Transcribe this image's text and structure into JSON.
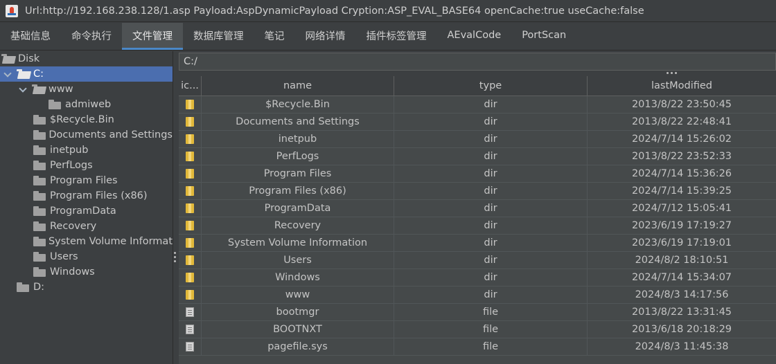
{
  "window": {
    "title": "Url:http://192.168.238.128/1.asp Payload:AspDynamicPayload Cryption:ASP_EVAL_BASE64 openCache:true useCache:false"
  },
  "tabs": [
    {
      "label": "基础信息"
    },
    {
      "label": "命令执行"
    },
    {
      "label": "文件管理",
      "active": true
    },
    {
      "label": "数据库管理"
    },
    {
      "label": "笔记"
    },
    {
      "label": "网络详情"
    },
    {
      "label": "插件标签管理"
    },
    {
      "label": "AEvalCode"
    },
    {
      "label": "PortScan"
    }
  ],
  "tree": {
    "root": "Disk",
    "drive_c": "C:",
    "www": "www",
    "admiweb": "admiweb",
    "items": [
      "$Recycle.Bin",
      "Documents and Settings",
      "inetpub",
      "PerfLogs",
      "Program Files",
      "Program Files (x86)",
      "ProgramData",
      "Recovery",
      "System Volume Informat",
      "Users",
      "Windows"
    ],
    "drive_d": "D:"
  },
  "path": "C:/",
  "table": {
    "headers": {
      "icon": "ic...",
      "name": "name",
      "type": "type",
      "lastModified": "lastModified"
    },
    "rows": [
      {
        "name": "$Recycle.Bin",
        "type": "dir",
        "lastModified": "2013/8/22 23:50:45"
      },
      {
        "name": "Documents and Settings",
        "type": "dir",
        "lastModified": "2013/8/22 22:48:41"
      },
      {
        "name": "inetpub",
        "type": "dir",
        "lastModified": "2024/7/14 15:26:02"
      },
      {
        "name": "PerfLogs",
        "type": "dir",
        "lastModified": "2013/8/22 23:52:33"
      },
      {
        "name": "Program Files",
        "type": "dir",
        "lastModified": "2024/7/14 15:36:26"
      },
      {
        "name": "Program Files (x86)",
        "type": "dir",
        "lastModified": "2024/7/14 15:39:25"
      },
      {
        "name": "ProgramData",
        "type": "dir",
        "lastModified": "2024/7/12 15:05:41"
      },
      {
        "name": "Recovery",
        "type": "dir",
        "lastModified": "2023/6/19 17:19:27"
      },
      {
        "name": "System Volume Information",
        "type": "dir",
        "lastModified": "2023/6/19 17:19:01"
      },
      {
        "name": "Users",
        "type": "dir",
        "lastModified": "2024/8/2 18:10:51"
      },
      {
        "name": "Windows",
        "type": "dir",
        "lastModified": "2024/7/14 15:34:07"
      },
      {
        "name": "www",
        "type": "dir",
        "lastModified": "2024/8/3 14:17:56"
      },
      {
        "name": "bootmgr",
        "type": "file",
        "lastModified": "2013/8/22 13:31:45"
      },
      {
        "name": "BOOTNXT",
        "type": "file",
        "lastModified": "2013/6/18 20:18:29"
      },
      {
        "name": "pagefile.sys",
        "type": "file",
        "lastModified": "2024/8/3 11:45:38"
      }
    ]
  }
}
